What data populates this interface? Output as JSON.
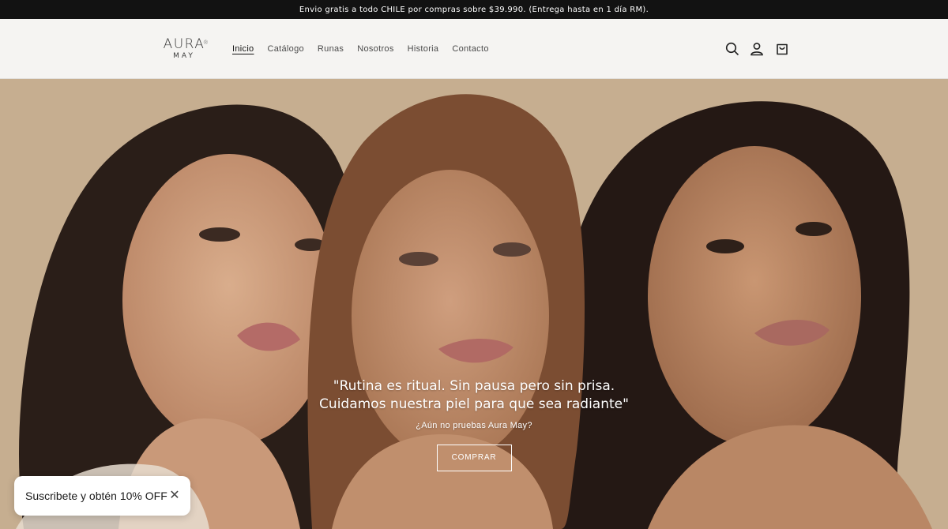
{
  "announcement": {
    "text": "Envio gratis a todo CHILE por compras sobre $39.990. (Entrega hasta en 1 día RM)."
  },
  "logo": {
    "line1": "AURA",
    "line2": "MAY",
    "mark": "®"
  },
  "nav": {
    "items": [
      {
        "label": "Inicio",
        "active": true
      },
      {
        "label": "Catálogo"
      },
      {
        "label": "Runas"
      },
      {
        "label": "Nosotros"
      },
      {
        "label": "Historia"
      },
      {
        "label": "Contacto"
      }
    ]
  },
  "header_icons": [
    "search-icon",
    "account-icon",
    "cart-icon"
  ],
  "hero": {
    "quote": "\"Rutina es ritual. Sin pausa pero sin prisa. Cuidamos nuestra piel para que sea radiante\"",
    "subtitle": "¿Aún no pruebas Aura May?",
    "button": "COMPRAR"
  },
  "popup": {
    "text": "Suscribete y obtén 10% OFF",
    "close": "✕"
  },
  "colors": {
    "announcement_bg": "#121212",
    "header_bg": "#f5f4f2",
    "hero_bg": "#c4ad8f"
  }
}
